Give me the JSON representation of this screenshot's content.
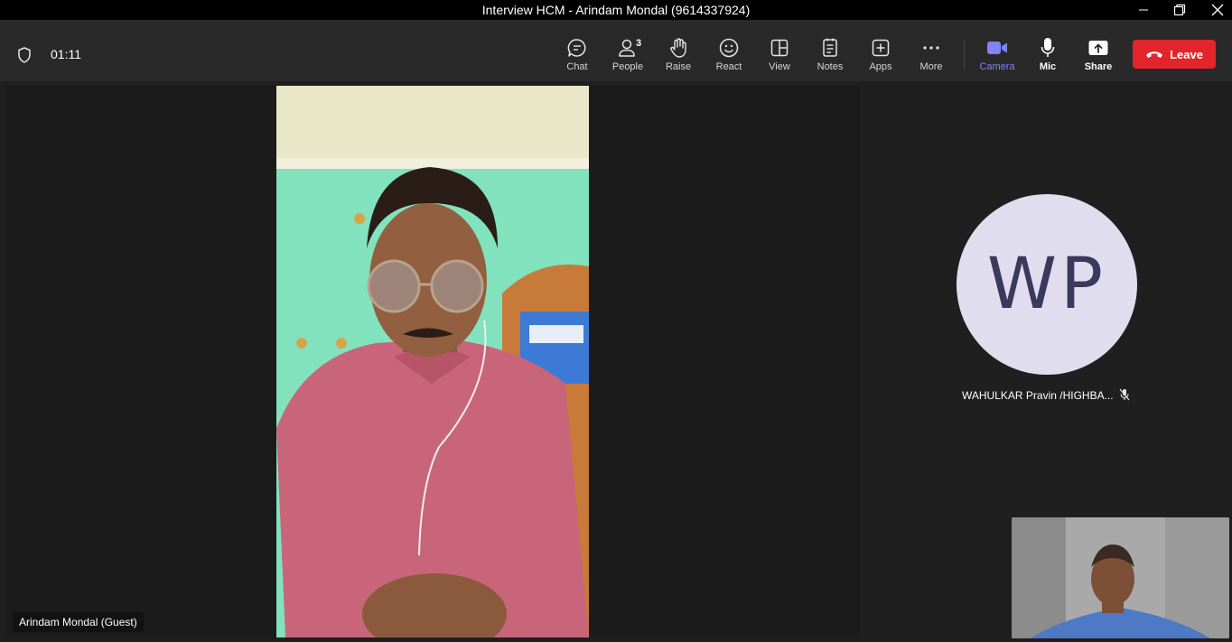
{
  "window": {
    "title": "Interview HCM - Arindam Mondal (9614337924)"
  },
  "toolbar": {
    "timer": "01:11",
    "buttons": {
      "chat": "Chat",
      "people": "People",
      "people_count": "3",
      "raise": "Raise",
      "react": "React",
      "view": "View",
      "notes": "Notes",
      "apps": "Apps",
      "more": "More",
      "camera": "Camera",
      "mic": "Mic",
      "share": "Share"
    },
    "leave_label": "Leave"
  },
  "stage": {
    "main_participant": "Arindam Mondal (Guest)",
    "side_participant": {
      "initials": "WP",
      "name": "WAHULKAR Pravin /HIGHBA..."
    }
  },
  "colors": {
    "accent": "#7f85f5",
    "leave": "#e3242b",
    "avatar_bg": "#e0deee",
    "avatar_text": "#3b3a5c"
  }
}
